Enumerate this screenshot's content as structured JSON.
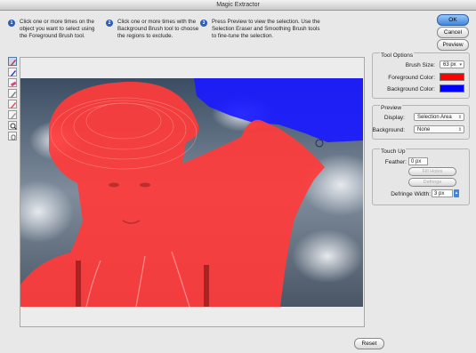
{
  "window": {
    "title": "Magic Extractor"
  },
  "instructions": [
    {
      "number": "1",
      "text": "Click one or more times on the object you want to select using the Foreground Brush tool."
    },
    {
      "number": "2",
      "text": "Click one or more times with the Background Brush tool to choose the regions to exclude."
    },
    {
      "number": "3",
      "text": "Press Preview to view the selection. Use the Selection Eraser and Smoothing Brush tools to fine-tune the selection."
    }
  ],
  "buttons": {
    "ok": "OK",
    "cancel": "Cancel",
    "preview": "Preview",
    "reset": "Reset",
    "fill_holes": "Fill Holes",
    "defringe": "Defringe"
  },
  "tools": [
    "foreground-brush-icon",
    "background-brush-icon",
    "point-eraser-icon",
    "add-to-selection-icon",
    "remove-from-selection-icon",
    "smoothing-brush-icon",
    "zoom-icon",
    "hand-icon"
  ],
  "tool_options": {
    "title": "Tool Options",
    "brush_size_label": "Brush Size:",
    "brush_size_value": "63 px",
    "foreground_label": "Foreground Color:",
    "foreground_color": "#ff0000",
    "background_label": "Background Color:",
    "background_color": "#0000ff"
  },
  "preview": {
    "title": "Preview",
    "display_label": "Display:",
    "display_value": "Selection Area",
    "background_label": "Background:",
    "background_value": "None"
  },
  "touch_up": {
    "title": "Touch Up",
    "feather_label": "Feather:",
    "feather_value": "0 px",
    "defringe_width_label": "Defringe Width:",
    "defringe_width_value": "3 px"
  }
}
